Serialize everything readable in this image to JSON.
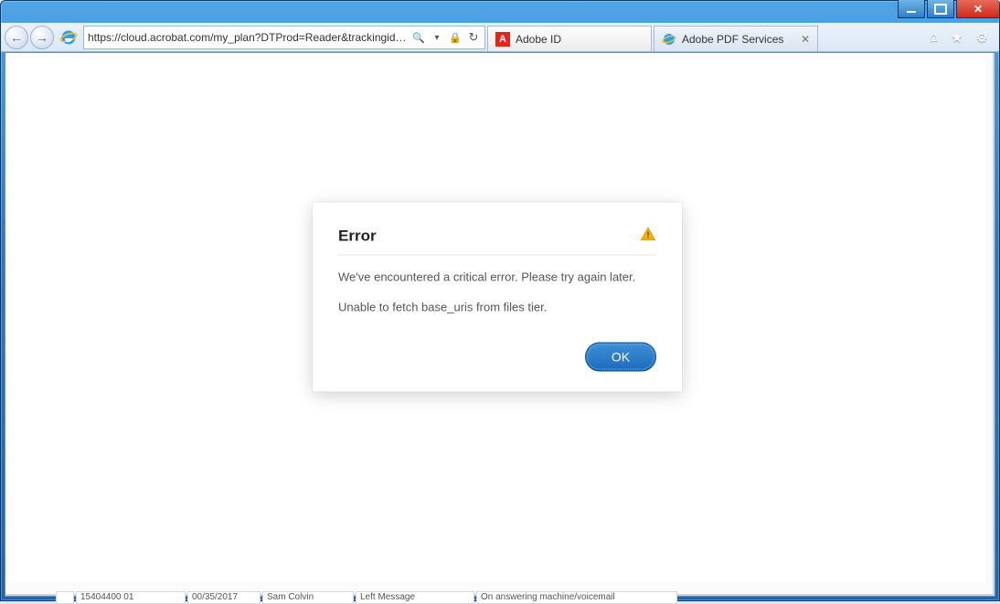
{
  "window_controls": {
    "min": "minimize",
    "max": "maximize",
    "close": "close"
  },
  "nav": {
    "url": "https://cloud.acrobat.com/my_plan?DTProd=Reader&trackingid=KRRTN&D",
    "url_bold_part": "acrobat.com"
  },
  "tabs": [
    {
      "label": "Adobe ID",
      "favicon": "adobe-a",
      "active": true
    },
    {
      "label": "Adobe PDF Services",
      "favicon": "ie",
      "active": false,
      "closable": true
    }
  ],
  "chrome_icons": {
    "home": "⌂",
    "favorites": "★",
    "settings": "⚙"
  },
  "dialog": {
    "title": "Error",
    "message1": "We've encountered a critical error. Please try again later.",
    "message2": "Unable to fetch base_uris from files tier.",
    "ok_label": "OK"
  },
  "bg_row": {
    "c1": "15404400 01",
    "c2": "00/35/2017",
    "c3": "Sam Colvin",
    "c4": "Left Message",
    "c5": "On answering machine/voicemail"
  }
}
